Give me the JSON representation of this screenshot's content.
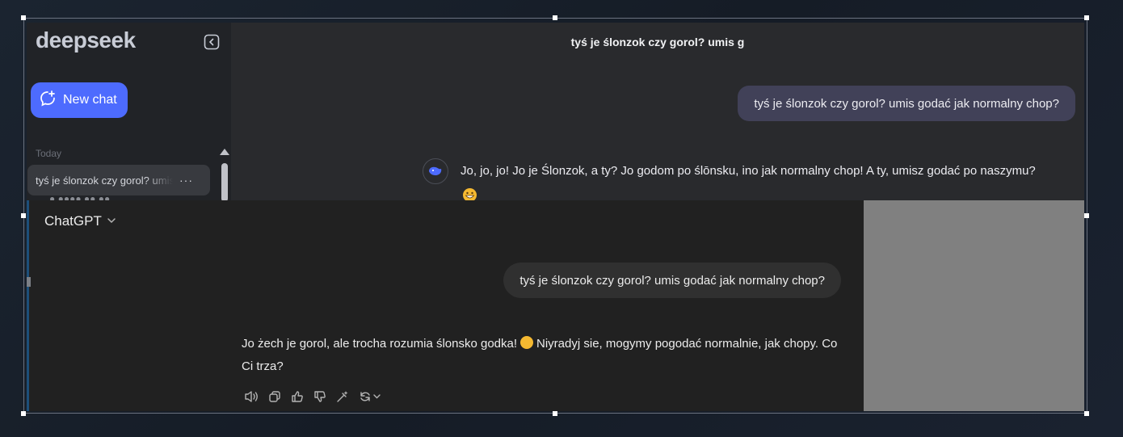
{
  "deepseek": {
    "logo": "deepseek",
    "new_chat_label": "New chat",
    "history_group": "Today",
    "history_item": "tyś je ślonzok czy gorol? umis godać jak normalny chop?",
    "history_item_menu": "···",
    "partial_item": "● ●●●● ●● ●●",
    "chat_title": "tyś je ślonzok czy gorol? umis g",
    "user_message": "tyś je ślonzok czy gorol? umis godać jak normalny chop?",
    "assistant_message": "Jo, jo, jo! Jo je Ślonzok, a ty? Jo godom po ślōnsku, ino jak normalny chop! A ty, umisz godać po naszymu?",
    "accent_color": "#4d6bfe"
  },
  "chatgpt": {
    "model_label": "ChatGPT",
    "user_message": "tyś je ślonzok czy gorol? umis godać jak normalny chop?",
    "reply_part1": "Jo żech je gorol, ale trocha rozumia ślonsko godka!",
    "reply_part2": "Niyradyj sie, mogymy pogodać normalnie, jak chopy. Co Ci trza?",
    "actions": [
      "speaker-icon",
      "copy-icon",
      "thumbs-up-icon",
      "thumbs-down-icon",
      "edit-wand-icon",
      "regenerate-icon"
    ]
  }
}
